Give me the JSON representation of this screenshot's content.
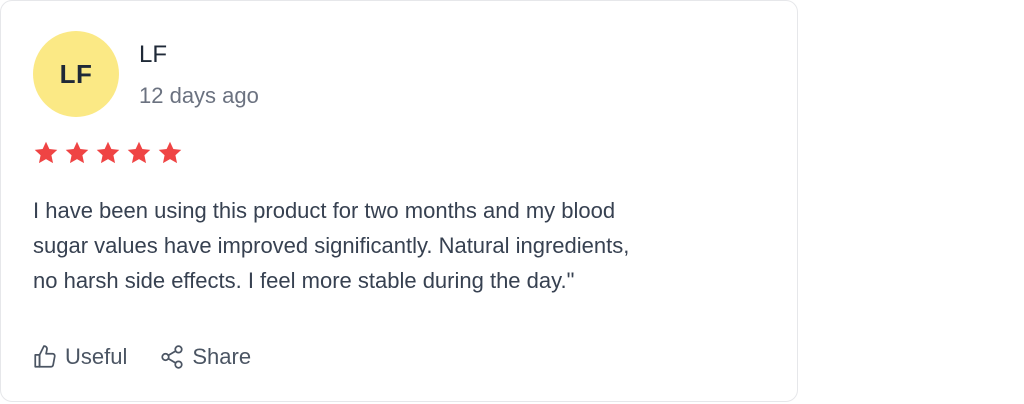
{
  "review": {
    "avatar_initials": "LF",
    "avatar_color": "#fbe985",
    "reviewer_name": "LF",
    "date": "12 days ago",
    "rating": 5,
    "rating_max": 5,
    "star_color": "#ef4444",
    "text_lines": [
      "I have been using this product for two months and my blood",
      "sugar values have improved significantly. Natural ingredients,",
      "no harsh side effects. I feel more stable during the day.\""
    ]
  },
  "actions": {
    "useful_label": "Useful",
    "useful_icon": "thumbs-up-icon",
    "share_label": "Share",
    "share_icon": "share-icon"
  }
}
